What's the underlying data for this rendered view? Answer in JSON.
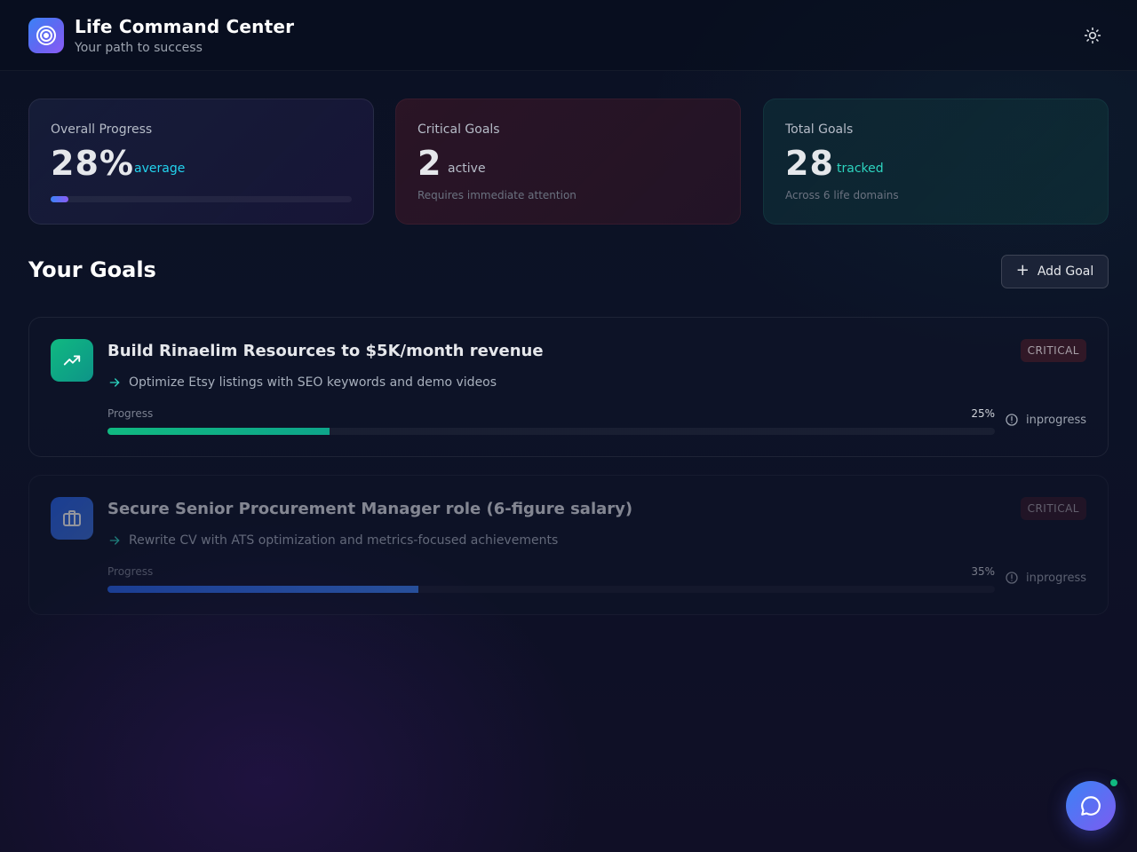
{
  "header": {
    "title": "Life Command Center",
    "subtitle": "Your path to success",
    "logo_icon": "target-icon",
    "theme_icon": "sun-icon"
  },
  "stats": {
    "overall": {
      "label": "Overall Progress",
      "value": "28%",
      "suffix": "average",
      "progress_percent": 6
    },
    "critical": {
      "label": "Critical Goals",
      "value": "2",
      "suffix": "active",
      "note": "Requires immediate attention"
    },
    "total": {
      "label": "Total Goals",
      "value": "28",
      "suffix": "tracked",
      "note": "Across 6 life domains"
    }
  },
  "section": {
    "title": "Your Goals",
    "add_plus": "+",
    "add_label": "Add Goal"
  },
  "goals": [
    {
      "title": "Build Rinaelim Resources to $5K/month revenue",
      "badge": "CRITICAL",
      "next_step": "Optimize Etsy listings with SEO keywords and demo videos",
      "progress_label": "Progress",
      "progress_text": "25%",
      "progress_percent": 25,
      "status": "inprogress",
      "icon": "trending-up-icon",
      "color": "#10b981"
    },
    {
      "title": "Secure Senior Procurement Manager role (6-figure salary)",
      "badge": "CRITICAL",
      "next_step": "Rewrite CV with ATS optimization and metrics-focused achievements",
      "progress_label": "Progress",
      "progress_text": "35%",
      "progress_percent": 35,
      "status": "inprogress",
      "icon": "briefcase-icon",
      "color": "#2563eb"
    }
  ],
  "colors": {
    "accent_blue": "#3b82f6",
    "accent_purple": "#8b5cf6",
    "accent_teal": "#2dd4bf",
    "accent_cyan": "#22d3ee",
    "online_green": "#10b981"
  },
  "chat": {
    "icon": "chat-bubble-icon"
  }
}
